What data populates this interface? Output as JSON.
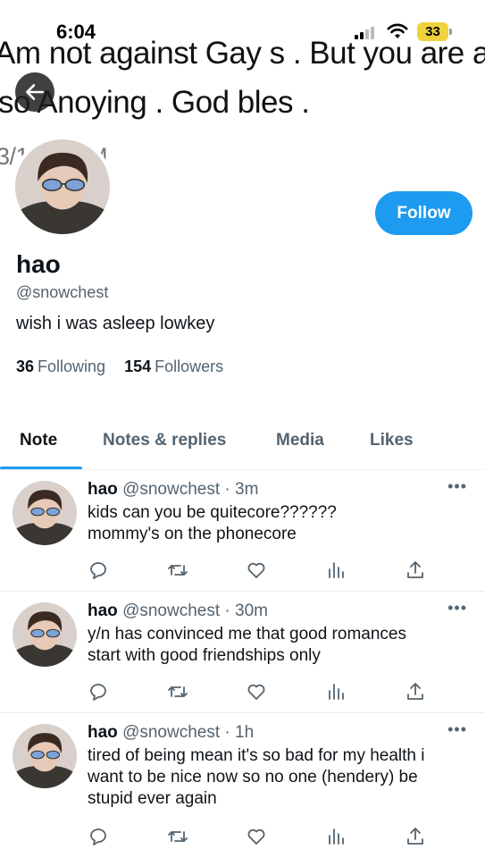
{
  "status_bar": {
    "time": "6:04",
    "battery": "33"
  },
  "banner": {
    "line1": "Am not against Gay s . But you are a",
    "line2": "so Anoying . God bles .",
    "line3": "3/1 :26 AM"
  },
  "profile": {
    "display_name": "hao",
    "handle": "@snowchest",
    "bio": "wish i was asleep lowkey",
    "following_count": "36",
    "following_label": "Following",
    "followers_count": "154",
    "followers_label": "Followers",
    "follow_label": "Follow"
  },
  "tabs": [
    {
      "label": "Note"
    },
    {
      "label": "Notes & replies"
    },
    {
      "label": "Media"
    },
    {
      "label": "Likes"
    }
  ],
  "posts": [
    {
      "name": "hao",
      "meta": "@snowchest · 3m",
      "text": "kids can you be quitecore??????\nmommy's on the phonecore"
    },
    {
      "name": "hao",
      "meta": "@snowchest · 30m",
      "text": "y/n has convinced me that good romances\nstart with good friendships only"
    },
    {
      "name": "hao",
      "meta": "@snowchest · 1h",
      "text": "tired of being mean it's so bad for my health i\nwant to be nice now so no one (hendery) be\nstupid ever again"
    }
  ],
  "colors": {
    "accent": "#1d9bf0",
    "secondary_text": "#536471",
    "battery": "#f0d23c"
  },
  "icons": [
    "back-arrow-icon",
    "reply-icon",
    "retweet-icon",
    "like-icon",
    "views-icon",
    "share-icon",
    "more-icon",
    "wifi-icon",
    "signal-icon",
    "battery-icon"
  ]
}
